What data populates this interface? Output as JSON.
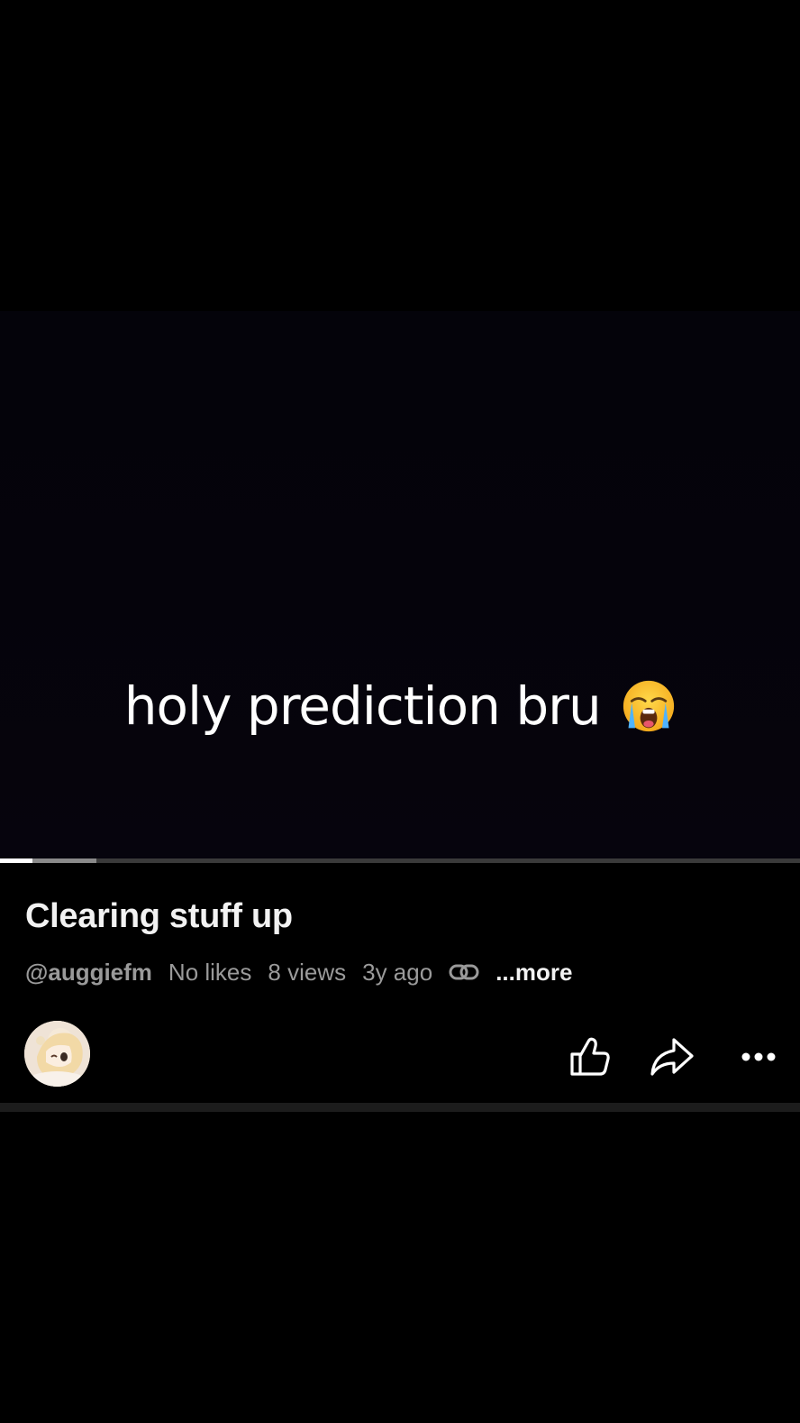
{
  "video": {
    "caption": "holy prediction bru",
    "caption_emoji": "loudly-crying-face",
    "progress_played_fraction": 0.04,
    "progress_buffered_fraction": 0.12
  },
  "details": {
    "title": "Clearing stuff up",
    "channel": "@auggiefm",
    "likes": "No likes",
    "views": "8 views",
    "age": "3y ago",
    "more": "...more"
  },
  "actions": {
    "like_icon": "thumbs-up-icon",
    "share_icon": "share-icon",
    "more_icon": "more-horizontal-icon"
  },
  "colors": {
    "background": "#000000",
    "text_primary": "#f2f2f2",
    "text_secondary": "#9a9a9a",
    "progress_track": "#3a3a3a",
    "progress_buffered": "#8a8a8a",
    "progress_played": "#ffffff"
  }
}
